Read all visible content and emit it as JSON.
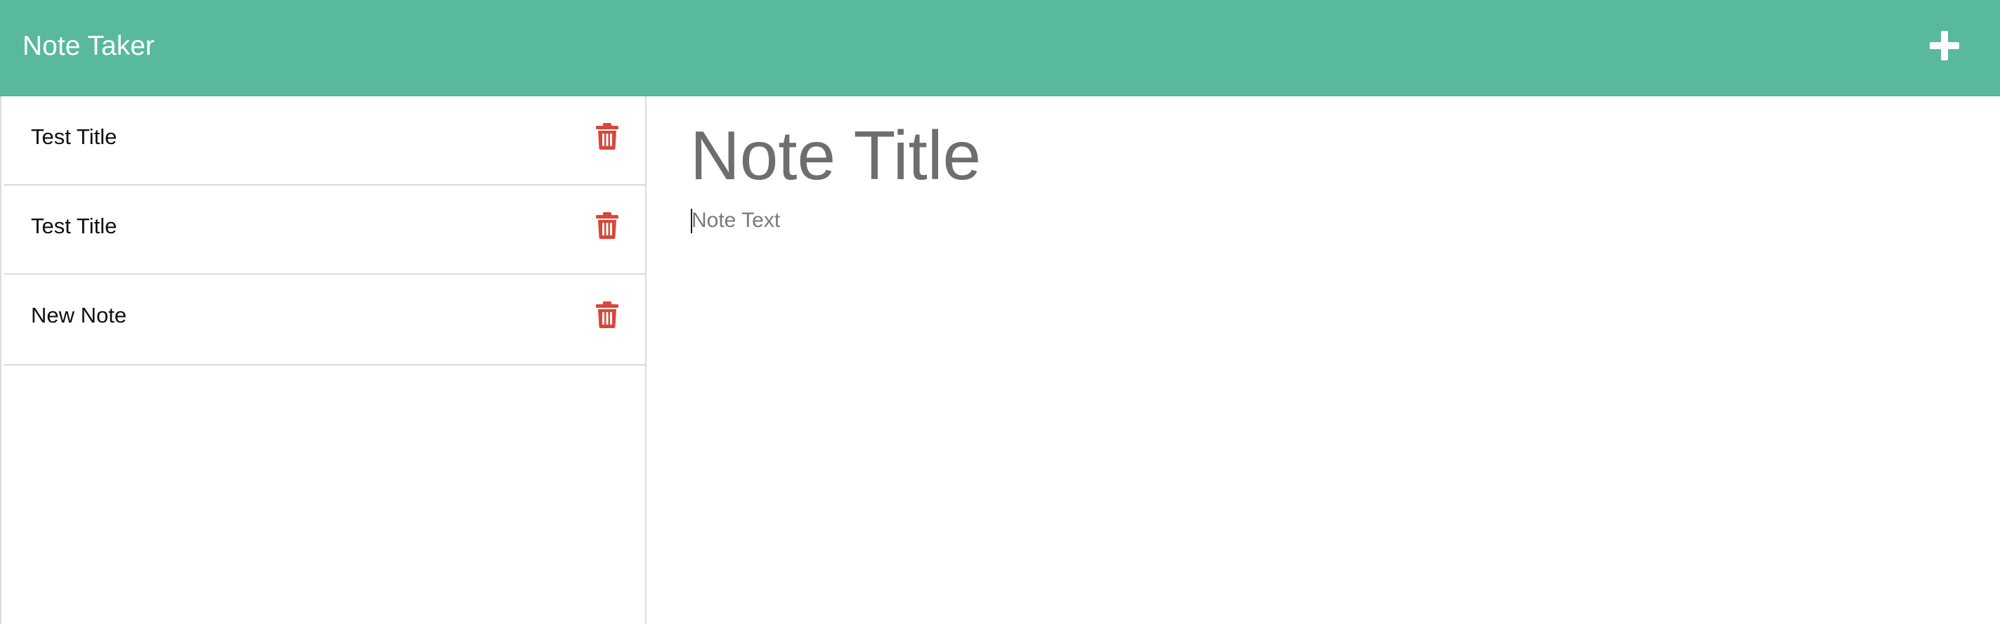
{
  "app": {
    "title": "Note Taker"
  },
  "toolbar": {
    "new_note_icon": "plus-icon",
    "accent_color": "#59b99c"
  },
  "sidebar": {
    "delete_icon": "trash-icon",
    "delete_color": "#d9473a",
    "notes": [
      {
        "title": "Test Title"
      },
      {
        "title": "Test Title"
      },
      {
        "title": "New Note"
      }
    ]
  },
  "editor": {
    "title_placeholder": "Note Title",
    "text_placeholder": "Note Text",
    "title_value": "",
    "text_value": ""
  }
}
